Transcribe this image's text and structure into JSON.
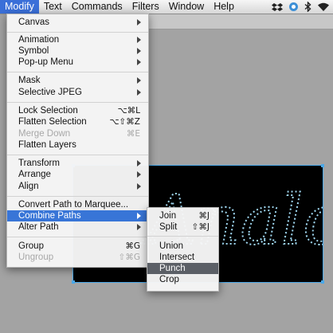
{
  "menubar": {
    "items": [
      "Modify",
      "Text",
      "Commands",
      "Filters",
      "Window",
      "Help"
    ]
  },
  "status_icons": [
    "dropbox-icon",
    "gear-globe-icon",
    "bluetooth-icon",
    "wifi-icon"
  ],
  "modify_menu": {
    "canvas": "Canvas",
    "animation": "Animation",
    "symbol": "Symbol",
    "popup_menu": "Pop-up Menu",
    "mask": "Mask",
    "selective_jpeg": "Selective JPEG",
    "lock_selection": "Lock Selection",
    "lock_selection_sc": "⌥⌘L",
    "flatten_selection": "Flatten Selection",
    "flatten_selection_sc": "⌥⇧⌘Z",
    "merge_down": "Merge Down",
    "merge_down_sc": "⌘E",
    "flatten_layers": "Flatten Layers",
    "transform": "Transform",
    "arrange": "Arrange",
    "align": "Align",
    "convert_path": "Convert Path to Marquee...",
    "combine_paths": "Combine Paths",
    "alter_path": "Alter Path",
    "group": "Group",
    "group_sc": "⌘G",
    "ungroup": "Ungroup",
    "ungroup_sc": "⇧⌘G"
  },
  "combine_paths_menu": {
    "join": "Join",
    "join_sc": "⌘J",
    "split": "Split",
    "split_sc": "⇧⌘J",
    "union": "Union",
    "intersect": "Intersect",
    "punch": "Punch",
    "crop": "Crop"
  },
  "canvas_text": "Analog",
  "colors": {
    "menu_highlight": "#3875d7",
    "submenu_highlight": "#5b5f66",
    "path_stroke": "#9fd7f0",
    "selection": "#4aa8e8"
  }
}
